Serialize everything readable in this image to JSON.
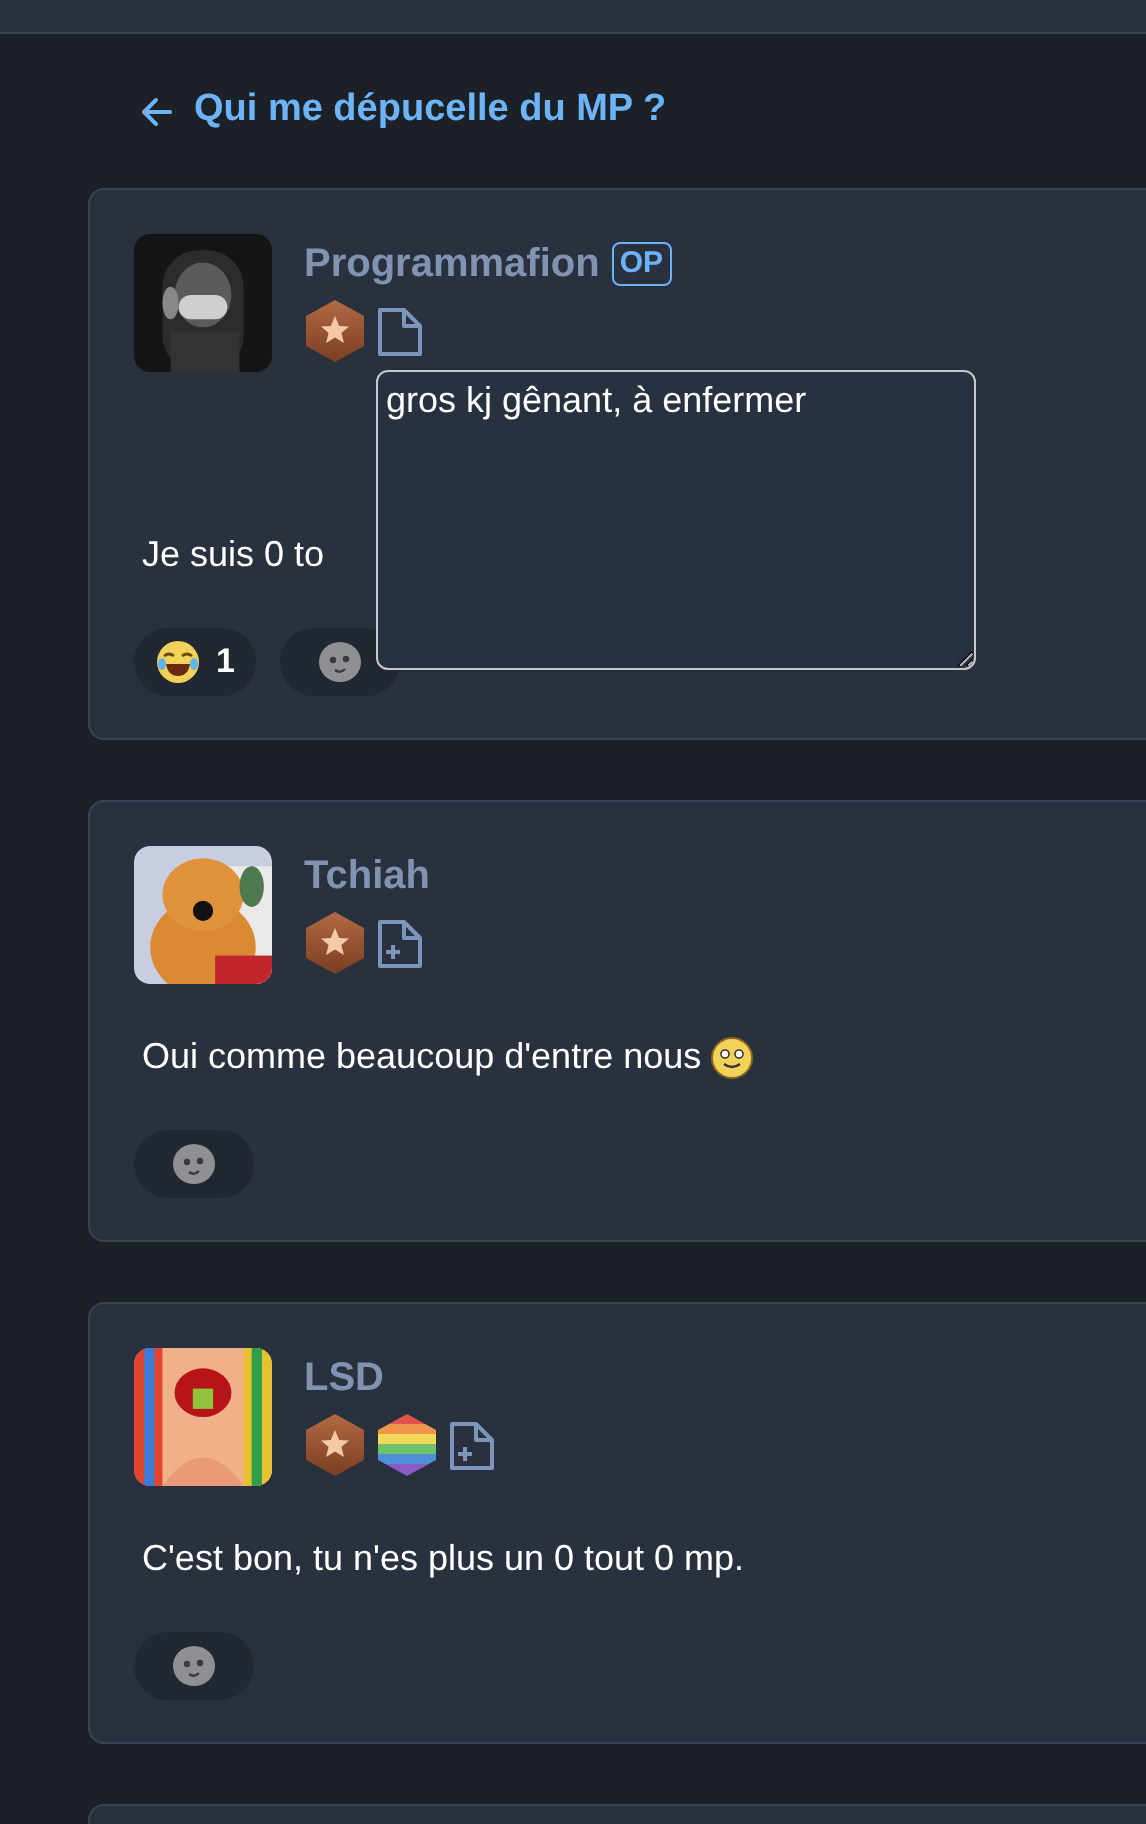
{
  "thread": {
    "title": "Qui me dépucelle du MP ?"
  },
  "posts": [
    {
      "author": "Programmafion",
      "op_badge": "OP",
      "badges": [
        {
          "kind": "star"
        },
        {
          "kind": "doc"
        }
      ],
      "text": "Je suis 0 to",
      "reactions": [
        {
          "kind": "laugh",
          "count": "1"
        },
        {
          "kind": "add"
        }
      ],
      "note": {
        "value": "gros kj gênant, à enfermer"
      }
    },
    {
      "author": "Tchiah",
      "badges": [
        {
          "kind": "star"
        },
        {
          "kind": "doc-plus"
        }
      ],
      "text": "Oui comme beaucoup d'entre nous",
      "text_emoji": true,
      "reactions": [
        {
          "kind": "add"
        }
      ]
    },
    {
      "author": "LSD",
      "badges": [
        {
          "kind": "star"
        },
        {
          "kind": "rainbow"
        },
        {
          "kind": "doc-plus"
        }
      ],
      "text": "C'est bon, tu n'es plus un 0 tout 0 mp.",
      "reactions": [
        {
          "kind": "add"
        }
      ]
    }
  ]
}
